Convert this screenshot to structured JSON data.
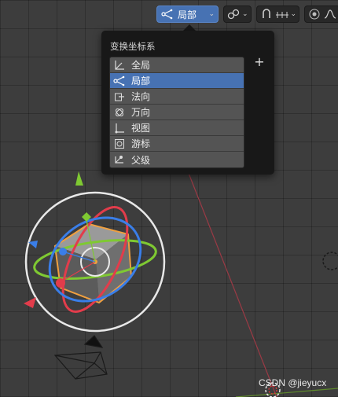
{
  "header": {
    "orientation": {
      "label": "局部",
      "icon": "local-orientation-icon"
    },
    "pivot": {
      "icon": "link-icon"
    },
    "snap": {
      "icon": "snap-icon"
    },
    "proportional": {
      "icon": "proportional-editing-icon"
    }
  },
  "popup": {
    "title": "变换坐标系",
    "add_label": "+",
    "items": [
      {
        "label": "全局",
        "icon": "global-icon",
        "selected": false
      },
      {
        "label": "局部",
        "icon": "local-icon",
        "selected": true
      },
      {
        "label": "法向",
        "icon": "normal-icon",
        "selected": false
      },
      {
        "label": "万向",
        "icon": "gimbal-icon",
        "selected": false
      },
      {
        "label": "视图",
        "icon": "view-icon",
        "selected": false
      },
      {
        "label": "游标",
        "icon": "cursor-icon",
        "selected": false
      },
      {
        "label": "父级",
        "icon": "parent-icon",
        "selected": false
      }
    ]
  },
  "watermark": "CSDN @jieyucx",
  "colors": {
    "accent": "#4772b3",
    "menu_bg": "#181818",
    "item_bg": "#545454",
    "viewport_bg": "#3d3d3d",
    "gizmo_x": "#e23c4b",
    "gizmo_y": "#7fc932",
    "gizmo_z": "#3a7ee8",
    "selection_outline": "#f0a040"
  }
}
